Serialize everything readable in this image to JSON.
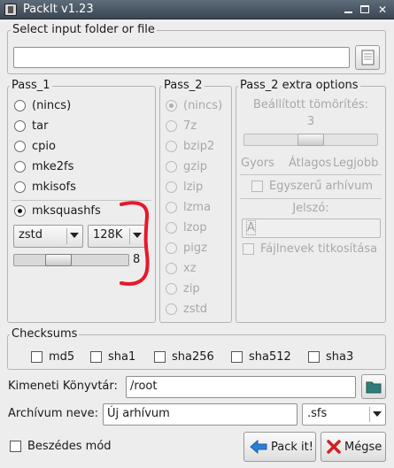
{
  "window": {
    "title": "PackIt v1.23"
  },
  "input": {
    "label": "Select input folder or file",
    "value": ""
  },
  "pass1": {
    "label": "Pass_1",
    "options": [
      "(nincs)",
      "tar",
      "cpio",
      "mke2fs",
      "mkisofs"
    ],
    "squash_option": "mksquashfs",
    "selected": "mksquashfs",
    "compressor": "zstd",
    "block_size": "128K",
    "level": "8",
    "level_fraction": 0.35
  },
  "pass2": {
    "label": "Pass_2",
    "options": [
      "(nincs)",
      "7z",
      "bzip2",
      "gzip",
      "lzip",
      "lzma",
      "lzop",
      "pigz",
      "xz",
      "zip",
      "zstd"
    ],
    "selected": "(nincs)"
  },
  "pass2_extra": {
    "label": "Pass_2 extra options",
    "compression_label": "Beállított tömörítés:",
    "compression_value": "3",
    "compression_fraction": 0.5,
    "scale_fast": "Gyors",
    "scale_avg": "Átlagos",
    "scale_best": "Legjobb",
    "simple_archive": "Egyszerű arhívum",
    "password_label": "Jelszó:",
    "password_value": "A",
    "encrypt_names": "Fájlnevek titkosítása"
  },
  "checksums": {
    "label": "Checksums",
    "items": [
      "md5",
      "sha1",
      "sha256",
      "sha512",
      "sha3"
    ]
  },
  "output": {
    "dir_label": "Kimeneti Könyvtár:",
    "dir_value": "/root",
    "name_label": "Archívum neve:",
    "name_value": "Új arhívum",
    "extension": ".sfs"
  },
  "footer": {
    "verbose": "Beszédes mód",
    "pack_button": "Pack it!",
    "cancel_button": "Mégse"
  },
  "colors": {
    "annotation": "#e8182a",
    "pack_icon": "#2a7fd4",
    "cancel_icon": "#d12020",
    "folder_icon": "#2e7d7a"
  }
}
